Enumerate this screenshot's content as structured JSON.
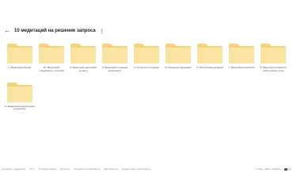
{
  "header": {
    "back_icon": "arrow-left-icon",
    "title": "10 медитаций на решение запроса",
    "more_icon": "more-vertical-icon"
  },
  "folders": [
    {
      "label": "1. Медитация Затрат"
    },
    {
      "label": "10. Медитация стремления к лучшему"
    },
    {
      "label": "2. Медитация настройки на день"
    },
    {
      "label": "3. Медитация создания реальности"
    },
    {
      "label": "4. Отпустить ситуацию"
    },
    {
      "label": "5. Прощение окружения"
    },
    {
      "label": "6. Исполнение желаний"
    },
    {
      "label": "7. Медитация изобилия"
    },
    {
      "label": "8. Медитация принятия себя и своего тела"
    },
    {
      "label": "9. Медитация закрепления результата"
    }
  ],
  "folder_colors": {
    "back": "#f2d27c",
    "front": "#fbe3a2"
  },
  "footer": {
    "links": [
      "Справка и поддержка",
      "Блог",
      "О Яндекс Диске",
      "Диск Pro",
      "Условия использования",
      "Для бизнеса",
      "Яндекс Диск для бизнеса"
    ],
    "copyright": "© 2012—2024 «Яндекс»",
    "lang": "RU",
    "lang_icon": "language-flag-icon"
  }
}
